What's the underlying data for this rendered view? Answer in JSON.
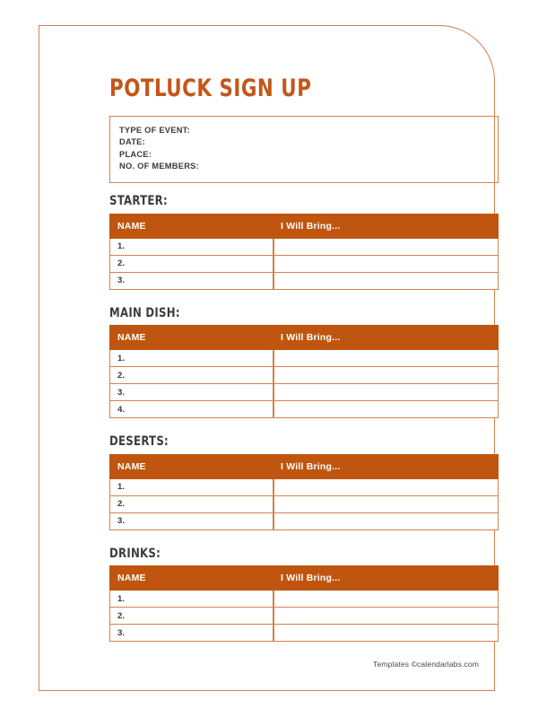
{
  "document": {
    "title": "POTLUCK SIGN UP",
    "accent_color": "#c0550f",
    "title_color": "#c4561a",
    "frame_color": "#d4814f"
  },
  "info_box": {
    "lines": [
      "TYPE OF EVENT:",
      "DATE:",
      "PLACE:",
      "NO. OF MEMBERS:"
    ]
  },
  "table_headers": {
    "name": "NAME",
    "bring": "I Will Bring..."
  },
  "sections": [
    {
      "title": "STARTER:",
      "rows": [
        "1.",
        "2.",
        "3."
      ],
      "values": [
        "",
        "",
        ""
      ]
    },
    {
      "title": "MAIN DISH:",
      "rows": [
        "1.",
        "2.",
        "3.",
        "4."
      ],
      "values": [
        "",
        "",
        "",
        ""
      ]
    },
    {
      "title": "DESERTS:",
      "rows": [
        "1.",
        "2.",
        "3."
      ],
      "values": [
        "",
        "",
        ""
      ]
    },
    {
      "title": "DRINKS:",
      "rows": [
        "1.",
        "2.",
        "3."
      ],
      "values": [
        "",
        "",
        ""
      ]
    }
  ],
  "footer": {
    "credit": "Templates ©calendarlabs.com"
  }
}
